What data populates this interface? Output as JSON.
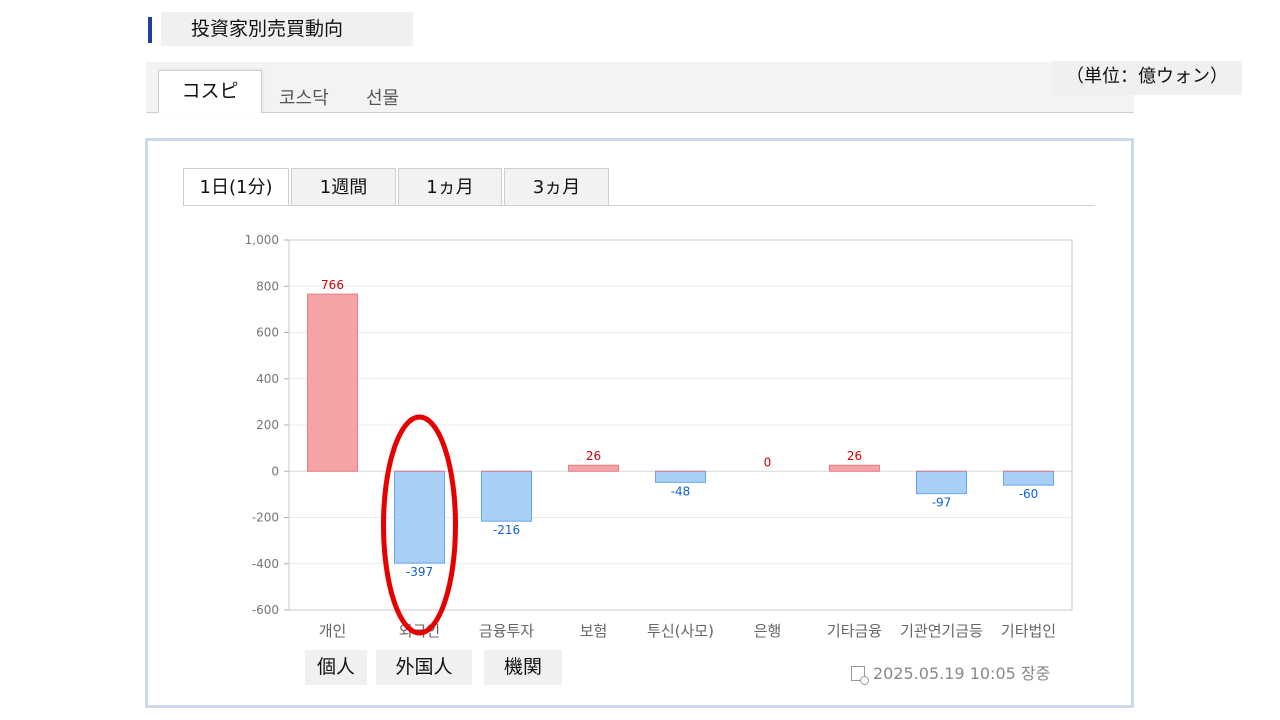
{
  "header": {
    "title": "投資家別売買動向",
    "unit": "（単位：億ウォン）"
  },
  "market_tabs": [
    {
      "label": "コスピ",
      "active": true
    },
    {
      "label": "코스닥",
      "active": false
    },
    {
      "label": "선물",
      "active": false
    }
  ],
  "period_tabs": [
    {
      "label": "1日(1分)",
      "active": true
    },
    {
      "label": "1週間",
      "active": false
    },
    {
      "label": "1ヵ月",
      "active": false
    },
    {
      "label": "3ヵ月",
      "active": false
    }
  ],
  "japanese_labels": [
    "個人",
    "外国人",
    "機関"
  ],
  "timestamp": "2025.05.19 10:05 장중",
  "colors": {
    "positive_fill": "#f5a3a6",
    "positive_stroke": "#e87d82",
    "positive_label": "#d40000",
    "negative_fill": "#a8d0f7",
    "negative_stroke": "#6aa6e8",
    "negative_label": "#1060d0",
    "highlight": "#e60000",
    "accent": "#1f3f9e"
  },
  "chart_data": {
    "type": "bar",
    "categories": [
      "개인",
      "외국인",
      "금융투자",
      "보험",
      "투신(사모)",
      "은행",
      "기타금융",
      "기관연기금등",
      "기타법인"
    ],
    "values": [
      766,
      -397,
      -216,
      26,
      -48,
      0,
      26,
      -97,
      -60
    ],
    "ylim": [
      -600,
      1000
    ],
    "yticks": [
      -600,
      -400,
      -200,
      0,
      200,
      400,
      600,
      800,
      1000
    ],
    "ytick_labels": [
      "-600",
      "-400",
      "-200",
      "0",
      "200",
      "400",
      "600",
      "800",
      "1,000"
    ],
    "grid": true,
    "highlight_category": "외국인"
  }
}
